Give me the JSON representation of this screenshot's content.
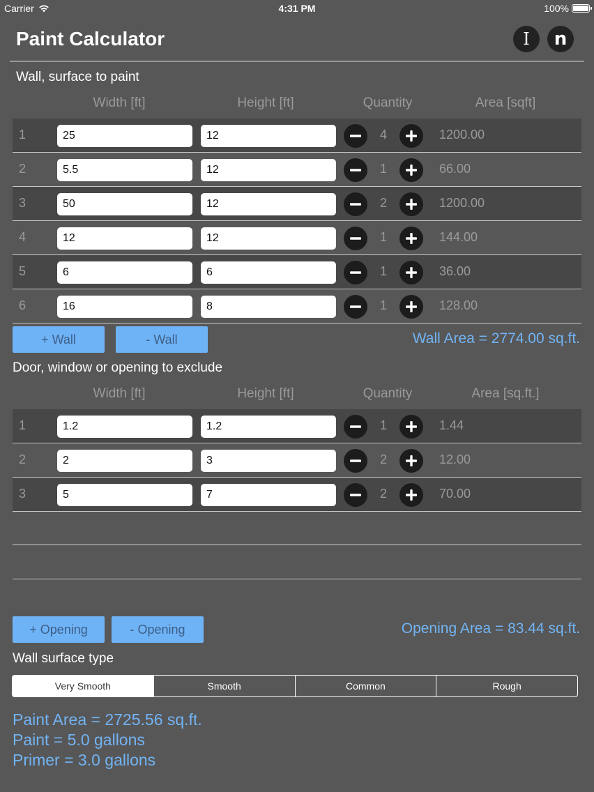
{
  "status_bar": {
    "carrier": "Carrier",
    "time": "4:31 PM",
    "battery": "100%"
  },
  "header": {
    "title": "Paint Calculator",
    "info_button": "I",
    "n_button": "n"
  },
  "walls": {
    "section_label": "Wall, surface to paint",
    "columns": [
      "Width [ft]",
      "Height [ft]",
      "Quantity",
      "Area [sqft]"
    ],
    "rows": [
      {
        "num": "1",
        "width": "25",
        "height": "12",
        "qty": "4",
        "area": "1200.00"
      },
      {
        "num": "2",
        "width": "5.5",
        "height": "12",
        "qty": "1",
        "area": "66.00"
      },
      {
        "num": "3",
        "width": "50",
        "height": "12",
        "qty": "2",
        "area": "1200.00"
      },
      {
        "num": "4",
        "width": "12",
        "height": "12",
        "qty": "1",
        "area": "144.00"
      },
      {
        "num": "5",
        "width": "6",
        "height": "6",
        "qty": "1",
        "area": "36.00"
      },
      {
        "num": "6",
        "width": "16",
        "height": "8",
        "qty": "1",
        "area": "128.00"
      }
    ],
    "add_label": "+ Wall",
    "remove_label": "- Wall",
    "total": "Wall Area = 2774.00 sq.ft."
  },
  "openings": {
    "section_label": "Door, window or opening to exclude",
    "columns": [
      "Width [ft]",
      "Height [ft]",
      "Quantity",
      "Area [sq.ft.]"
    ],
    "rows": [
      {
        "num": "1",
        "width": "1.2",
        "height": "1.2",
        "qty": "1",
        "area": "1.44"
      },
      {
        "num": "2",
        "width": "2",
        "height": "3",
        "qty": "2",
        "area": "12.00"
      },
      {
        "num": "3",
        "width": "5",
        "height": "7",
        "qty": "2",
        "area": "70.00"
      }
    ],
    "add_label": "+ Opening",
    "remove_label": "- Opening",
    "total": "Opening Area = 83.44 sq.ft."
  },
  "surface": {
    "label": "Wall surface type",
    "options": [
      "Very Smooth",
      "Smooth",
      "Common",
      "Rough"
    ],
    "selected": "Very Smooth"
  },
  "results": {
    "paint_area": "Paint Area = 2725.56 sq.ft.",
    "paint": "Paint = 5.0 gallons",
    "primer": "Primer = 3.0 gallons"
  },
  "colors": {
    "background": "#575757",
    "row_shade": "#474747",
    "accent_blue": "#72b4f5",
    "button_blue": "#6fb3f7"
  }
}
